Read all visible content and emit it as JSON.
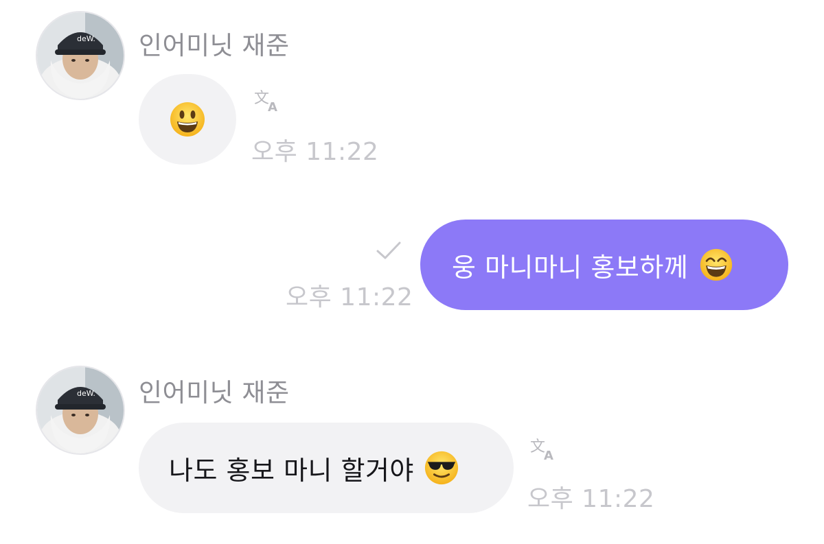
{
  "messages": [
    {
      "direction": "incoming",
      "sender": "인어미닛 재준",
      "emoji": "grinning-face",
      "time": "오후 11:22"
    },
    {
      "direction": "outgoing",
      "text": "웅 마니마니 홍보하께",
      "emoji": "smiling-face-with-open-mouth-and-smiling-eyes",
      "time": "오후 11:22",
      "status": "read-check"
    },
    {
      "direction": "incoming",
      "sender": "인어미닛 재준",
      "text": "나도 홍보 마니 할거야",
      "emoji": "smiling-face-with-sunglasses",
      "time": "오후 11:22"
    }
  ],
  "icons": {
    "translate": "translate-icon",
    "check": "check-icon"
  },
  "colors": {
    "outgoing_bubble": "#8c79f7",
    "incoming_bubble": "#f2f2f4",
    "timestamp": "#c7c7cc",
    "sender_name": "#8e8e94"
  }
}
